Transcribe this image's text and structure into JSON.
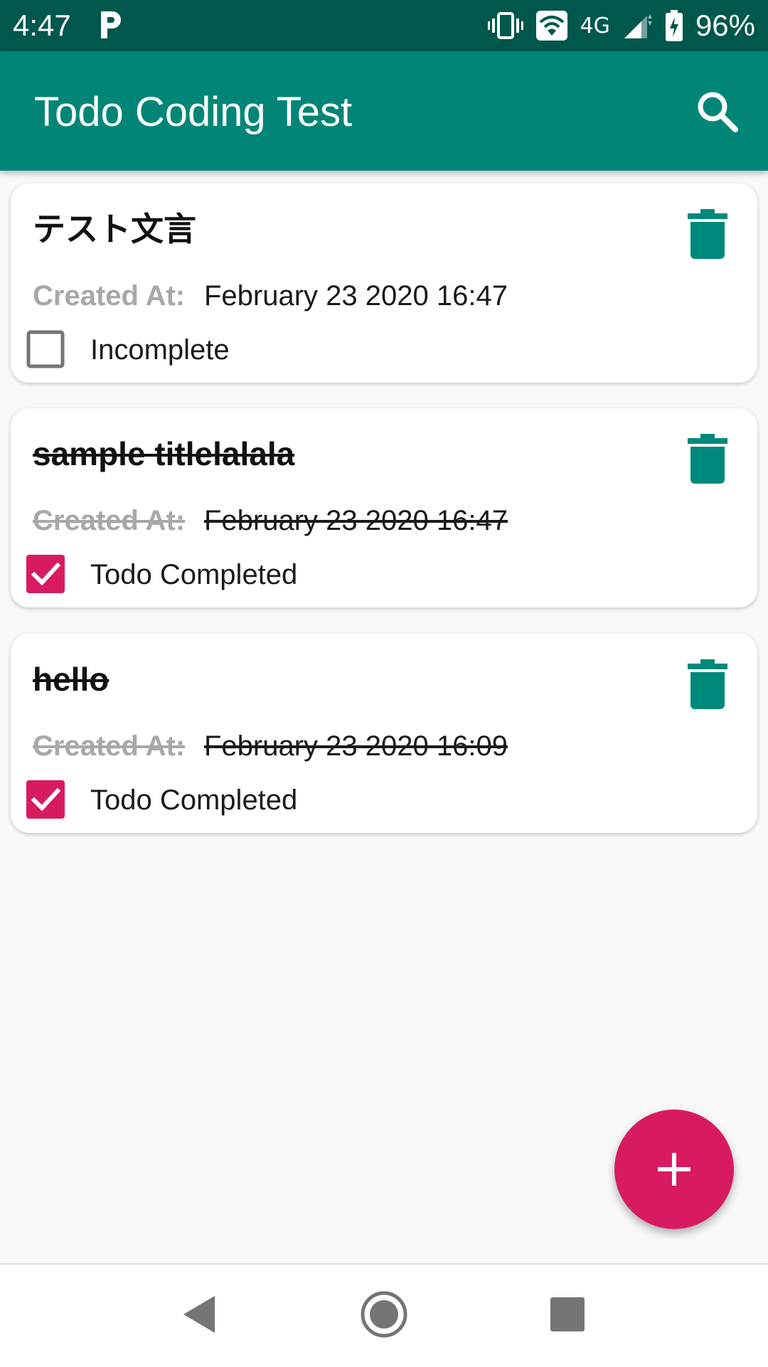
{
  "status_bar": {
    "time": "4:47",
    "network": "4G",
    "battery": "96%",
    "icons": [
      "parking-app-icon",
      "vibrate-icon",
      "wifi-icon",
      "signal-icon",
      "battery-charging-icon"
    ]
  },
  "app_bar": {
    "title": "Todo Coding Test",
    "search_icon": "search-icon"
  },
  "todos": [
    {
      "title": "テスト文言",
      "created_label": "Created At:",
      "created_value": "February 23 2020 16:47",
      "checked": false,
      "status": "Incomplete"
    },
    {
      "title": "sample titlelalala",
      "created_label": "Created At:",
      "created_value": "February 23 2020 16:47",
      "checked": true,
      "status": "Todo Completed"
    },
    {
      "title": "hello",
      "created_label": "Created At:",
      "created_value": "February 23 2020 16:09",
      "checked": true,
      "status": "Todo Completed"
    }
  ],
  "fab": {
    "icon": "plus-icon"
  },
  "nav_bar": {
    "icons": [
      "back-icon",
      "home-icon",
      "recents-icon"
    ]
  },
  "colors": {
    "status_bar": "#00574b",
    "app_bar": "#008577",
    "accent": "#d81b60",
    "delete_icon": "#00897b",
    "label_gray": "#a8a8a8",
    "background": "#f8f8f8"
  }
}
